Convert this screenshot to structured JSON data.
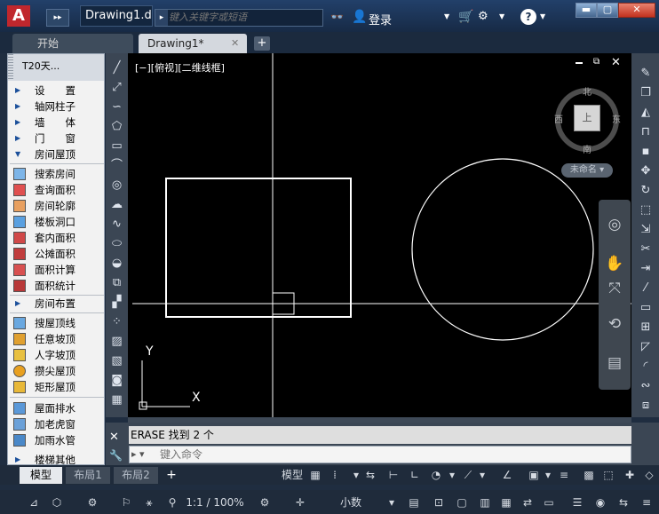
{
  "titlebar": {
    "app_logo": "A",
    "doc_title": "Drawing1.d...",
    "search_placeholder": "键入关键字或短语",
    "login_label": "登录",
    "help_symbol": "?"
  },
  "file_tabs": {
    "start_label": "开始",
    "drawing_label": "Drawing1*",
    "close_symbol": "✕",
    "add_symbol": "+"
  },
  "left_panel": {
    "header": "T20天...",
    "categories": [
      {
        "label": "设　　置"
      },
      {
        "label": "轴网柱子"
      },
      {
        "label": "墙　　体"
      },
      {
        "label": "门　　窗"
      },
      {
        "label": "房间屋顶"
      }
    ],
    "room_tools": [
      {
        "label": "搜索房间"
      },
      {
        "label": "查询面积"
      },
      {
        "label": "房间轮廓"
      },
      {
        "label": "楼板洞口"
      },
      {
        "label": "套内面积"
      },
      {
        "label": "公摊面积"
      },
      {
        "label": "面积计算"
      },
      {
        "label": "面积统计"
      }
    ],
    "layout_item": {
      "label": "房间布置"
    },
    "roof_tools": [
      {
        "label": "搜屋顶线"
      },
      {
        "label": "任意坡顶"
      },
      {
        "label": "人字坡顶"
      },
      {
        "label": "攒尖屋顶"
      },
      {
        "label": "矩形屋顶"
      }
    ],
    "drain_tools": [
      {
        "label": "屋面排水"
      },
      {
        "label": "加老虎窗"
      },
      {
        "label": "加雨水管"
      },
      {
        "label": "楼梯其他"
      }
    ]
  },
  "viewport": {
    "view_label": "[−][俯视][二维线框]",
    "compass": {
      "north": "北",
      "south": "南",
      "east": "东",
      "west": "西",
      "top_face": "上"
    },
    "wcs_label": "未命名 ▾",
    "ucs_x": "X",
    "ucs_y": "Y"
  },
  "command": {
    "history": "ERASE 找到 2 个",
    "input_placeholder": "键入命令",
    "prompt_icon": "▸ ▾"
  },
  "layout_tabs": {
    "model": "模型",
    "layout1": "布局1",
    "layout2": "布局2",
    "add": "+"
  },
  "status": {
    "model_label": "模型",
    "scale_label": "1:1 / 100%",
    "units_label": "小数"
  }
}
